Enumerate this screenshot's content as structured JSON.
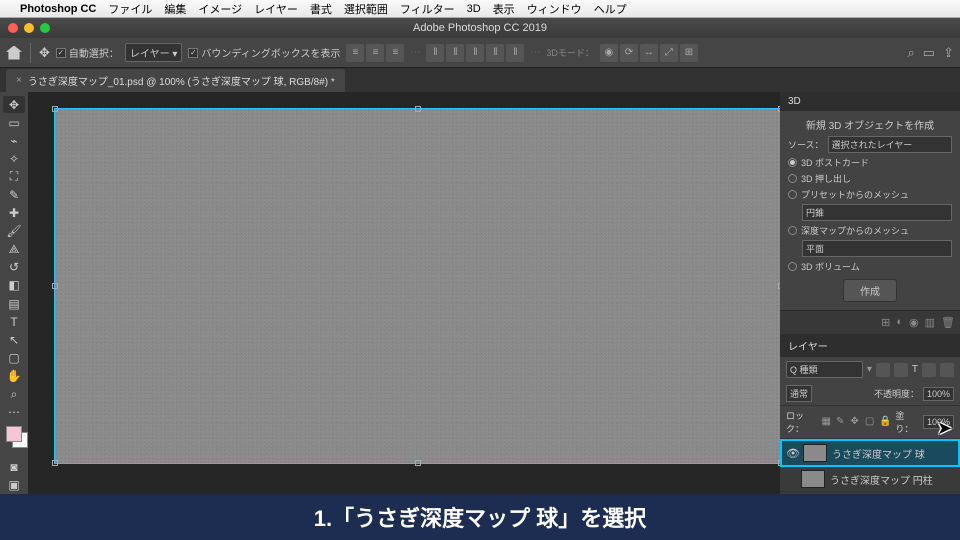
{
  "mac_menu": {
    "app": "Photoshop CC",
    "items": [
      "ファイル",
      "編集",
      "イメージ",
      "レイヤー",
      "書式",
      "選択範囲",
      "フィルター",
      "3D",
      "表示",
      "ウィンドウ",
      "ヘルプ"
    ]
  },
  "window_title": "Adobe Photoshop CC 2019",
  "options": {
    "auto_select": "自動選択：",
    "layer_dropdown": "レイヤー ▾",
    "bounding": "バウンディングボックスを表示",
    "mode_label": "3Dモード："
  },
  "doc_tab": {
    "name": "うさぎ深度マップ_01.psd @ 100% (うさぎ深度マップ 球, RGB/8#) *"
  },
  "p3d": {
    "tab": "3D",
    "title": "新規 3D オブジェクトを作成",
    "source_label": "ソース：",
    "source_val": "選択されたレイヤー",
    "opt1": "3D ポストカード",
    "opt2": "3D 押し出し",
    "opt3": "プリセットからのメッシュ",
    "opt3_sub": "円錐",
    "opt4": "深度マップからのメッシュ",
    "opt4_sub": "平面",
    "opt5": "3D ボリューム",
    "create": "作成"
  },
  "layers": {
    "tab": "レイヤー",
    "search": "Q 種類",
    "blend": "通常",
    "opacity_label": "不透明度：",
    "opacity": "100%",
    "lock_label": "ロック：",
    "fill_label": "塗り：",
    "fill": "100%",
    "items": [
      {
        "name": "うさぎ深度マップ 球",
        "visible": true,
        "selected": true
      },
      {
        "name": "うさぎ深度マップ 円柱",
        "visible": false,
        "selected": false
      }
    ]
  },
  "caption": "1.「うさぎ深度マップ 球」を選択"
}
